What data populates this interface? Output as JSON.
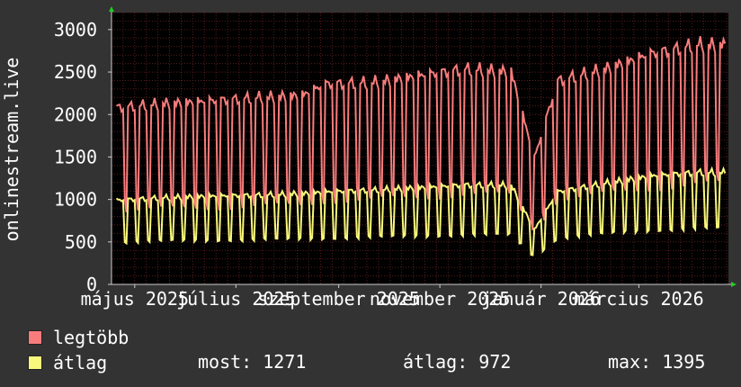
{
  "colors": {
    "background": "#333333",
    "plot_background": "#000000",
    "grid": "#5a1e1e",
    "max_series": "#f87c7c",
    "avg_series": "#f8f87c",
    "axis_arrow": "#22cc22"
  },
  "chart_data": {
    "type": "line",
    "ylabel": "onlinestream.live",
    "ylim": [
      0,
      3200
    ],
    "yticks": [
      0,
      500,
      1000,
      1500,
      2000,
      2500,
      3000
    ],
    "xlim": [
      "2025-04-17",
      "2026-04-24"
    ],
    "xticks": [
      {
        "date": "2025-05-01",
        "label": "május 2025"
      },
      {
        "date": "2025-07-01",
        "label": "július 2025"
      },
      {
        "date": "2025-09-01",
        "label": "szeptember 2025"
      },
      {
        "date": "2025-11-01",
        "label": "november 2025"
      },
      {
        "date": "2026-01-01",
        "label": "január 2026"
      },
      {
        "date": "2026-03-01",
        "label": "március 2026"
      }
    ],
    "grid": true,
    "series": [
      {
        "name": "legtöbb",
        "color": "#f87c7c",
        "weekly_peak": [
          [
            "2025-04-20",
            2100
          ],
          [
            "2025-05-18",
            2150
          ],
          [
            "2025-06-15",
            2180
          ],
          [
            "2025-07-13",
            2220
          ],
          [
            "2025-08-10",
            2250
          ],
          [
            "2025-08-24",
            2380
          ],
          [
            "2025-09-21",
            2400
          ],
          [
            "2025-10-19",
            2480
          ],
          [
            "2025-11-16",
            2560
          ],
          [
            "2025-12-14",
            2530
          ],
          [
            "2025-12-28",
            1500
          ],
          [
            "2026-01-11",
            2420
          ],
          [
            "2026-02-08",
            2560
          ],
          [
            "2026-03-08",
            2740
          ],
          [
            "2026-04-05",
            2850
          ],
          [
            "2026-04-19",
            2850
          ]
        ],
        "daily_low": 850
      },
      {
        "name": "átlag",
        "color": "#f8f87c",
        "weekly_peak": [
          [
            "2025-04-20",
            1000
          ],
          [
            "2025-05-18",
            1030
          ],
          [
            "2025-06-15",
            1050
          ],
          [
            "2025-07-13",
            1060
          ],
          [
            "2025-08-10",
            1080
          ],
          [
            "2025-08-24",
            1100
          ],
          [
            "2025-09-21",
            1120
          ],
          [
            "2025-10-19",
            1150
          ],
          [
            "2025-11-16",
            1180
          ],
          [
            "2025-12-14",
            1180
          ],
          [
            "2025-12-28",
            650
          ],
          [
            "2026-01-11",
            1100
          ],
          [
            "2026-02-08",
            1200
          ],
          [
            "2026-03-08",
            1290
          ],
          [
            "2026-04-05",
            1330
          ],
          [
            "2026-04-19",
            1330
          ]
        ],
        "daily_low": 550
      }
    ]
  },
  "legend": {
    "max_label": "legtöbb",
    "avg_label": "átlag",
    "now": "most: 1271",
    "average": "átlag: 972",
    "maximum": "max: 1395"
  }
}
